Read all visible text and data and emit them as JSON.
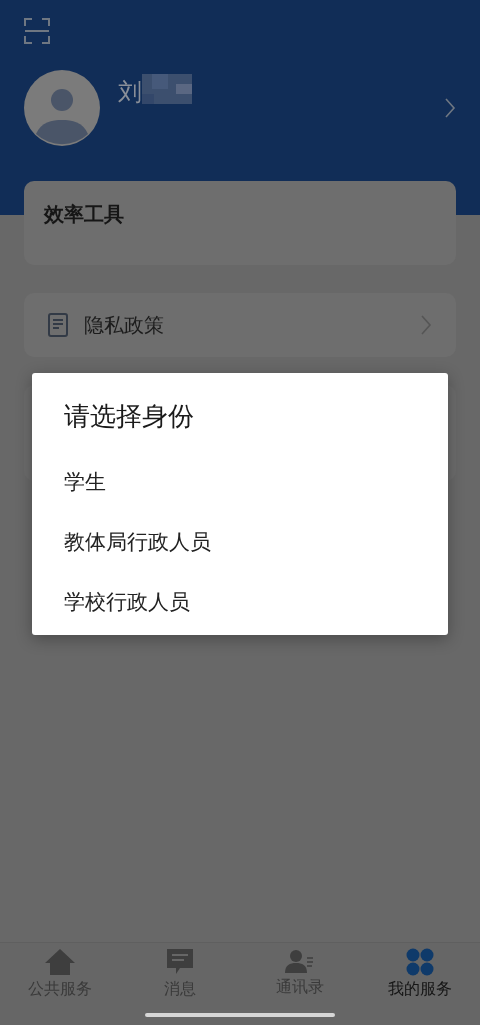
{
  "profile": {
    "name": "刘"
  },
  "tools_card": {
    "title": "效率工具"
  },
  "menu": [
    {
      "label": "隐私政策"
    }
  ],
  "dialog": {
    "title": "请选择身份",
    "options": [
      {
        "label": "学生"
      },
      {
        "label": "教体局行政人员"
      },
      {
        "label": "学校行政人员"
      }
    ]
  },
  "tabs": [
    {
      "label": "公共服务",
      "kind": "home",
      "selected": false
    },
    {
      "label": "消息",
      "kind": "message",
      "selected": false
    },
    {
      "label": "通讯录",
      "kind": "contacts",
      "selected": false
    },
    {
      "label": "我的服务",
      "kind": "services",
      "selected": true
    }
  ]
}
